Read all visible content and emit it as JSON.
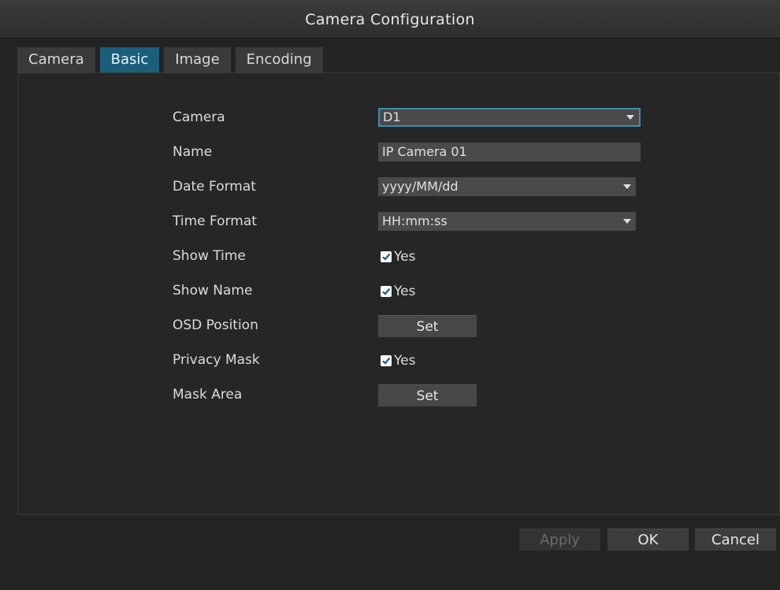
{
  "window": {
    "title": "Camera Configuration"
  },
  "tabs": [
    {
      "label": "Camera",
      "active": false
    },
    {
      "label": "Basic",
      "active": true
    },
    {
      "label": "Image",
      "active": false
    },
    {
      "label": "Encoding",
      "active": false
    }
  ],
  "form": {
    "camera": {
      "label": "Camera",
      "value": "D1"
    },
    "name": {
      "label": "Name",
      "value": "IP Camera 01"
    },
    "date_format": {
      "label": "Date Format",
      "value": "yyyy/MM/dd"
    },
    "time_format": {
      "label": "Time Format",
      "value": "HH:mm:ss"
    },
    "show_time": {
      "label": "Show Time",
      "option": "Yes",
      "checked": true
    },
    "show_name": {
      "label": "Show Name",
      "option": "Yes",
      "checked": true
    },
    "osd_position": {
      "label": "OSD Position",
      "button": "Set"
    },
    "privacy_mask": {
      "label": "Privacy Mask",
      "option": "Yes",
      "checked": true
    },
    "mask_area": {
      "label": "Mask Area",
      "button": "Set"
    }
  },
  "footer": {
    "apply_label": "Apply",
    "ok_label": "OK",
    "cancel_label": "Cancel"
  },
  "colors": {
    "accent": "#1a5e7a",
    "focus_border": "#3c8fb0",
    "background": "#232323"
  },
  "icons": {
    "dropdown": "chevron-down-icon",
    "checkbox": "checkmark-icon"
  }
}
